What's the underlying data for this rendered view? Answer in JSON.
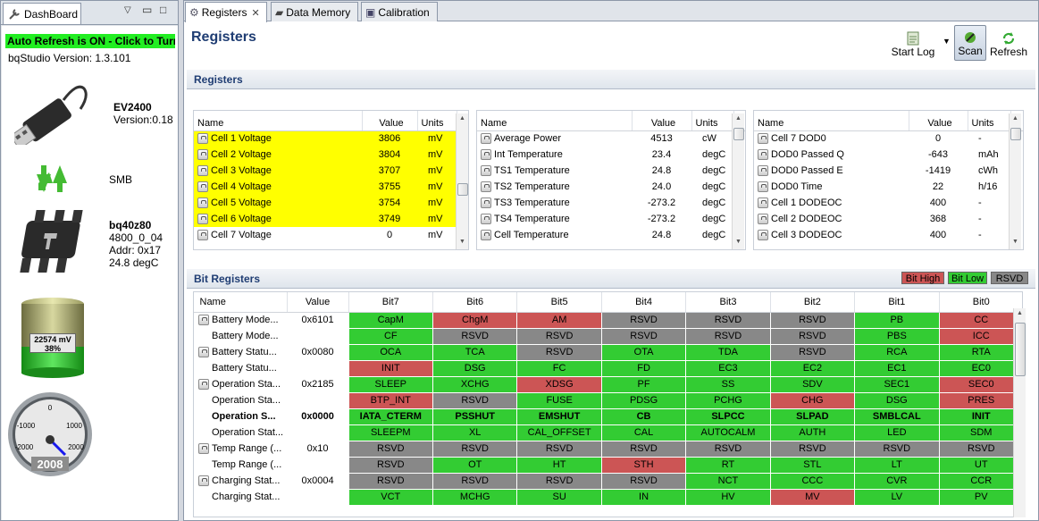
{
  "dashboard": {
    "tab_label": "DashBoard",
    "auto_refresh": "Auto Refresh is ON - Click to Turn",
    "version": "bqStudio Version:  1.3.101",
    "ev": {
      "name": "EV2400",
      "version": "Version:0.18"
    },
    "smb": "SMB",
    "chip": {
      "name": "bq40z80",
      "fw": "4800_0_04",
      "addr": "Addr: 0x17",
      "temp": "24.8 degC"
    },
    "battery": {
      "voltage": "22574 mV",
      "percent": "38%",
      "level": 0.38
    },
    "gauge": {
      "value": "2008",
      "ticks": [
        "0",
        "-1000",
        "1000",
        "-2000",
        "2000"
      ]
    }
  },
  "tabs": [
    {
      "label": "Registers",
      "active": true
    },
    {
      "label": "Data Memory",
      "active": false
    },
    {
      "label": "Calibration",
      "active": false
    }
  ],
  "page_title": "Registers",
  "toolbar": {
    "start_log": "Start Log",
    "scan": "Scan",
    "refresh": "Refresh"
  },
  "registers_section": "Registers",
  "reg_headers": {
    "name": "Name",
    "value": "Value",
    "units": "Units"
  },
  "reg_tables": [
    {
      "rows": [
        {
          "name": "Cell 1 Voltage",
          "value": "3806",
          "units": "mV",
          "hl": true
        },
        {
          "name": "Cell 2 Voltage",
          "value": "3804",
          "units": "mV",
          "hl": true
        },
        {
          "name": "Cell 3 Voltage",
          "value": "3707",
          "units": "mV",
          "hl": true
        },
        {
          "name": "Cell 4 Voltage",
          "value": "3755",
          "units": "mV",
          "hl": true
        },
        {
          "name": "Cell 5 Voltage",
          "value": "3754",
          "units": "mV",
          "hl": true
        },
        {
          "name": "Cell 6 Voltage",
          "value": "3749",
          "units": "mV",
          "hl": true
        },
        {
          "name": "Cell 7 Voltage",
          "value": "0",
          "units": "mV",
          "hl": false
        }
      ]
    },
    {
      "rows": [
        {
          "name": "Average Power",
          "value": "4513",
          "units": "cW"
        },
        {
          "name": "Int Temperature",
          "value": "23.4",
          "units": "degC"
        },
        {
          "name": "TS1 Temperature",
          "value": "24.8",
          "units": "degC"
        },
        {
          "name": "TS2 Temperature",
          "value": "24.0",
          "units": "degC"
        },
        {
          "name": "TS3 Temperature",
          "value": "-273.2",
          "units": "degC"
        },
        {
          "name": "TS4 Temperature",
          "value": "-273.2",
          "units": "degC"
        },
        {
          "name": "Cell Temperature",
          "value": "24.8",
          "units": "degC"
        }
      ]
    },
    {
      "rows": [
        {
          "name": "Cell 7 DOD0",
          "value": "0",
          "units": "-"
        },
        {
          "name": "DOD0 Passed Q",
          "value": "-643",
          "units": "mAh"
        },
        {
          "name": "DOD0 Passed E",
          "value": "-1419",
          "units": "cWh"
        },
        {
          "name": "DOD0 Time",
          "value": "22",
          "units": "h/16"
        },
        {
          "name": "Cell 1 DODEOC",
          "value": "400",
          "units": "-"
        },
        {
          "name": "Cell 2 DODEOC",
          "value": "368",
          "units": "-"
        },
        {
          "name": "Cell 3 DODEOC",
          "value": "400",
          "units": "-"
        }
      ]
    }
  ],
  "bit_section": "Bit Registers",
  "legend": {
    "high": "Bit High",
    "low": "Bit Low",
    "rsvd": "RSVD"
  },
  "bit_headers": [
    "Name",
    "Value",
    "Bit7",
    "Bit6",
    "Bit5",
    "Bit4",
    "Bit3",
    "Bit2",
    "Bit1",
    "Bit0"
  ],
  "bit_rows": [
    {
      "name": "Battery Mode...",
      "value": "0x6101",
      "icon": "pencil",
      "bits": [
        [
          "CapM",
          "g"
        ],
        [
          "ChgM",
          "r"
        ],
        [
          "AM",
          "r"
        ],
        [
          "RSVD",
          "y"
        ],
        [
          "RSVD",
          "y"
        ],
        [
          "RSVD",
          "y"
        ],
        [
          "PB",
          "g"
        ],
        [
          "CC",
          "r"
        ]
      ]
    },
    {
      "name": "Battery Mode...",
      "value": "",
      "icon": "",
      "bits": [
        [
          "CF",
          "g"
        ],
        [
          "RSVD",
          "y"
        ],
        [
          "RSVD",
          "y"
        ],
        [
          "RSVD",
          "y"
        ],
        [
          "RSVD",
          "y"
        ],
        [
          "RSVD",
          "y"
        ],
        [
          "PBS",
          "g"
        ],
        [
          "ICC",
          "r"
        ]
      ]
    },
    {
      "name": "Battery Statu...",
      "value": "0x0080",
      "icon": "lock",
      "bits": [
        [
          "OCA",
          "g"
        ],
        [
          "TCA",
          "g"
        ],
        [
          "RSVD",
          "y"
        ],
        [
          "OTA",
          "g"
        ],
        [
          "TDA",
          "g"
        ],
        [
          "RSVD",
          "y"
        ],
        [
          "RCA",
          "g"
        ],
        [
          "RTA",
          "g"
        ]
      ]
    },
    {
      "name": "Battery Statu...",
      "value": "",
      "icon": "",
      "bits": [
        [
          "INIT",
          "r"
        ],
        [
          "DSG",
          "g"
        ],
        [
          "FC",
          "g"
        ],
        [
          "FD",
          "g"
        ],
        [
          "EC3",
          "g"
        ],
        [
          "EC2",
          "g"
        ],
        [
          "EC1",
          "g"
        ],
        [
          "EC0",
          "g"
        ]
      ]
    },
    {
      "name": "Operation Sta...",
      "value": "0x2185",
      "icon": "lock",
      "bits": [
        [
          "SLEEP",
          "g"
        ],
        [
          "XCHG",
          "g"
        ],
        [
          "XDSG",
          "r"
        ],
        [
          "PF",
          "g"
        ],
        [
          "SS",
          "g"
        ],
        [
          "SDV",
          "g"
        ],
        [
          "SEC1",
          "g"
        ],
        [
          "SEC0",
          "r"
        ]
      ]
    },
    {
      "name": "Operation Sta...",
      "value": "",
      "icon": "",
      "bits": [
        [
          "BTP_INT",
          "r"
        ],
        [
          "RSVD",
          "y"
        ],
        [
          "FUSE",
          "g"
        ],
        [
          "PDSG",
          "g"
        ],
        [
          "PCHG",
          "g"
        ],
        [
          "CHG",
          "r"
        ],
        [
          "DSG",
          "g"
        ],
        [
          "PRES",
          "r"
        ]
      ]
    },
    {
      "name": "Operation S...",
      "value": "0x0000",
      "icon": "",
      "bold": true,
      "bits": [
        [
          "IATA_CTERM",
          "g"
        ],
        [
          "PSSHUT",
          "g"
        ],
        [
          "EMSHUT",
          "g"
        ],
        [
          "CB",
          "g"
        ],
        [
          "SLPCC",
          "g"
        ],
        [
          "SLPAD",
          "g"
        ],
        [
          "SMBLCAL",
          "g"
        ],
        [
          "INIT",
          "g"
        ]
      ]
    },
    {
      "name": "Operation Stat...",
      "value": "",
      "icon": "",
      "bits": [
        [
          "SLEEPM",
          "g"
        ],
        [
          "XL",
          "g"
        ],
        [
          "CAL_OFFSET",
          "g"
        ],
        [
          "CAL",
          "g"
        ],
        [
          "AUTOCALM",
          "g"
        ],
        [
          "AUTH",
          "g"
        ],
        [
          "LED",
          "g"
        ],
        [
          "SDM",
          "g"
        ]
      ]
    },
    {
      "name": "Temp Range (...",
      "value": "0x10",
      "icon": "lock",
      "bits": [
        [
          "RSVD",
          "y"
        ],
        [
          "RSVD",
          "y"
        ],
        [
          "RSVD",
          "y"
        ],
        [
          "RSVD",
          "y"
        ],
        [
          "RSVD",
          "y"
        ],
        [
          "RSVD",
          "y"
        ],
        [
          "RSVD",
          "y"
        ],
        [
          "RSVD",
          "y"
        ]
      ]
    },
    {
      "name": "Temp Range (...",
      "value": "",
      "icon": "",
      "bits": [
        [
          "RSVD",
          "y"
        ],
        [
          "OT",
          "g"
        ],
        [
          "HT",
          "g"
        ],
        [
          "STH",
          "r"
        ],
        [
          "RT",
          "g"
        ],
        [
          "STL",
          "g"
        ],
        [
          "LT",
          "g"
        ],
        [
          "UT",
          "g"
        ]
      ]
    },
    {
      "name": "Charging Stat...",
      "value": "0x0004",
      "icon": "lock",
      "bits": [
        [
          "RSVD",
          "y"
        ],
        [
          "RSVD",
          "y"
        ],
        [
          "RSVD",
          "y"
        ],
        [
          "RSVD",
          "y"
        ],
        [
          "NCT",
          "g"
        ],
        [
          "CCC",
          "g"
        ],
        [
          "CVR",
          "g"
        ],
        [
          "CCR",
          "g"
        ]
      ]
    },
    {
      "name": "Charging Stat...",
      "value": "",
      "icon": "",
      "bits": [
        [
          "VCT",
          "g"
        ],
        [
          "MCHG",
          "g"
        ],
        [
          "SU",
          "g"
        ],
        [
          "IN",
          "g"
        ],
        [
          "HV",
          "g"
        ],
        [
          "MV",
          "r"
        ],
        [
          "LV",
          "g"
        ],
        [
          "PV",
          "g"
        ]
      ]
    }
  ]
}
